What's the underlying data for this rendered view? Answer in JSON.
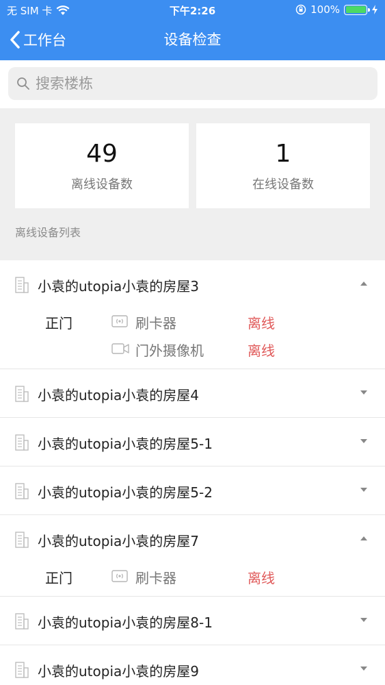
{
  "status_bar": {
    "carrier": "无 SIM 卡",
    "time": "下午2:26",
    "battery": "100%"
  },
  "nav": {
    "back_label": "工作台",
    "title": "设备检查"
  },
  "search": {
    "placeholder": "搜索楼栋"
  },
  "stats": {
    "offline_count": "49",
    "offline_label": "离线设备数",
    "online_count": "1",
    "online_label": "在线设备数"
  },
  "list_caption": "离线设备列表",
  "groups": [
    {
      "name": "小袁的utopia小袁的房屋3",
      "expanded": true,
      "devices": [
        {
          "door": "正门",
          "icon": "card-reader-icon",
          "name": "刷卡器",
          "status": "离线"
        },
        {
          "door": "",
          "icon": "camera-icon",
          "name": "门外摄像机",
          "status": "离线"
        }
      ]
    },
    {
      "name": "小袁的utopia小袁的房屋4",
      "expanded": false,
      "devices": []
    },
    {
      "name": "小袁的utopia小袁的房屋5-1",
      "expanded": false,
      "devices": []
    },
    {
      "name": "小袁的utopia小袁的房屋5-2",
      "expanded": false,
      "devices": []
    },
    {
      "name": "小袁的utopia小袁的房屋7",
      "expanded": true,
      "devices": [
        {
          "door": "正门",
          "icon": "card-reader-icon",
          "name": "刷卡器",
          "status": "离线"
        }
      ]
    },
    {
      "name": "小袁的utopia小袁的房屋8-1",
      "expanded": false,
      "devices": []
    },
    {
      "name": "小袁的utopia小袁的房屋9",
      "expanded": false,
      "devices": []
    }
  ],
  "colors": {
    "header_bg": "#3c8ef1",
    "offline_red": "#e05a5a",
    "page_gray": "#efefef"
  }
}
